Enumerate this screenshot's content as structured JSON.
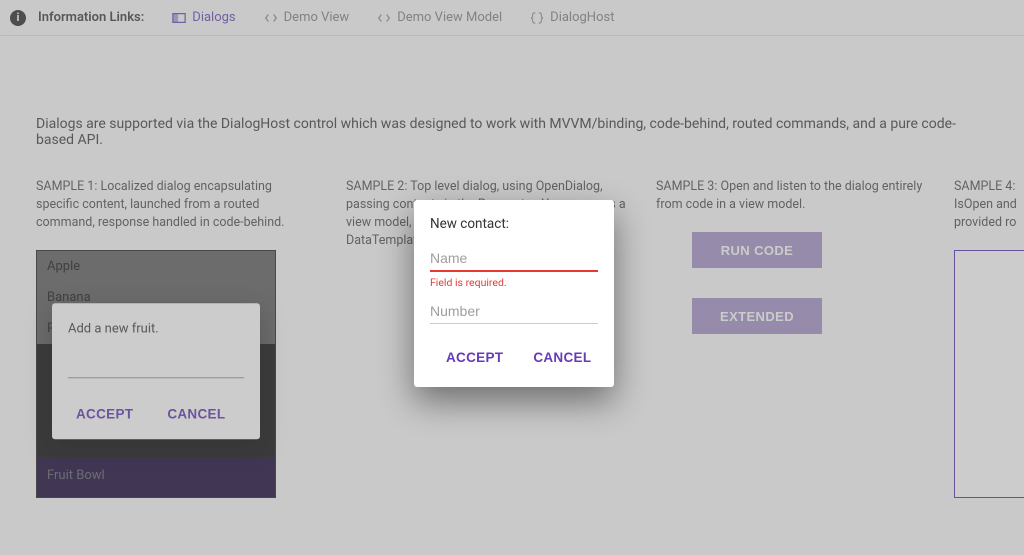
{
  "toolbar": {
    "heading": "Information Links:",
    "links": [
      {
        "label": "Dialogs"
      },
      {
        "label": "Demo View"
      },
      {
        "label": "Demo View Model"
      },
      {
        "label": "DialogHost"
      }
    ]
  },
  "intro": "Dialogs are supported via the DialogHost control which was designed to work with MVVM/binding, code-behind, routed commands, and a pure code-based API.",
  "samples": {
    "s1": {
      "title": "SAMPLE 1: Localized dialog encapsulating specific content, launched from a routed command, response handled in code-behind.",
      "items": [
        "Apple",
        "Banana",
        "P"
      ],
      "footer": "Fruit Bowl",
      "dialog": {
        "title": "Add a new fruit.",
        "accept": "ACCEPT",
        "cancel": "CANCEL"
      }
    },
    "s2": {
      "title": "SAMPLE 2: Top level dialog, using OpenDialog, passing content via the Parameter. You can pass a view model, provided a corresponding DataTemplate can be found in ",
      "dialog": {
        "heading": "New contact:",
        "name_placeholder": "Name",
        "name_error": "Field is required.",
        "number_placeholder": "Number",
        "accept": "ACCEPT",
        "cancel": "CANCEL"
      }
    },
    "s3": {
      "title": "SAMPLE 3: Open and listen to the dialog entirely from code in a view model.",
      "run": "RUN CODE",
      "extended": "EXTENDED"
    },
    "s4": {
      "title": "SAMPLE 4: IsOpen and provided ro",
      "badge": "+"
    }
  }
}
